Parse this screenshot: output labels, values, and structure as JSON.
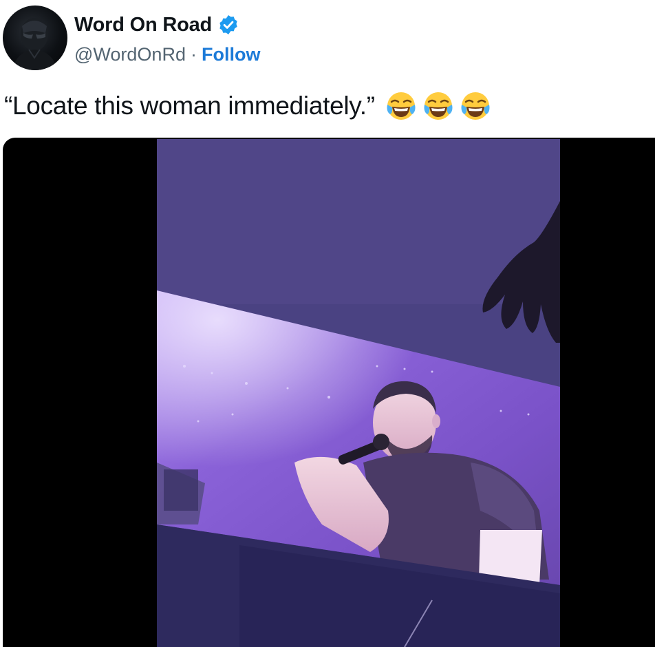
{
  "author": {
    "display_name": "Word On Road",
    "handle": "@WordOnRd",
    "separator": "·",
    "follow_label": "Follow",
    "verified": true,
    "verified_color": "#1d9bf0",
    "avatar_icon": "avatar-image"
  },
  "tweet": {
    "text": "“Locate this woman immediately.”",
    "emojis": [
      "face-with-tears-of-joy-icon",
      "face-with-tears-of-joy-icon",
      "face-with-tears-of-joy-icon"
    ]
  },
  "media": {
    "type": "video",
    "letterbox_color": "#000000",
    "accent_color": "#7b5fd1"
  },
  "colors": {
    "text_primary": "#0f1419",
    "text_secondary": "#536471",
    "link": "#1d7bd8"
  }
}
